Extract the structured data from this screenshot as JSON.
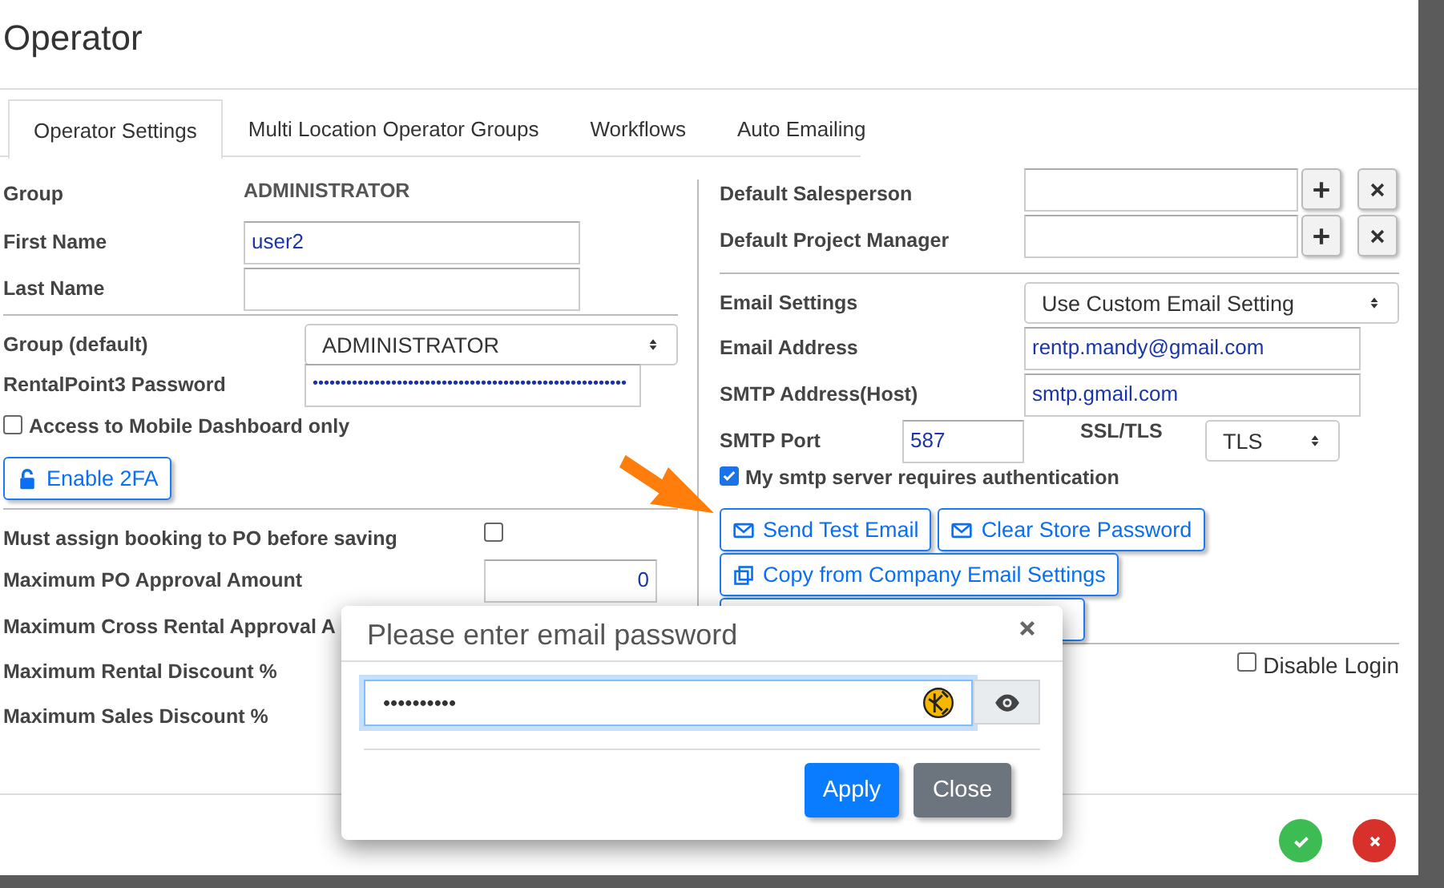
{
  "window": {
    "title": "Operator"
  },
  "tabs": [
    {
      "label": "Operator Settings",
      "selected": true
    },
    {
      "label": "Multi Location Operator Groups",
      "selected": false
    },
    {
      "label": "Workflows",
      "selected": false
    },
    {
      "label": "Auto Emailing",
      "selected": false
    }
  ],
  "left": {
    "sections": [
      [
        {
          "kind": "value",
          "label": "Group",
          "value": "ADMINISTRATOR"
        },
        {
          "kind": "input",
          "label": "First Name",
          "value": "user2"
        },
        {
          "kind": "input",
          "label": "Last Name"
        }
      ],
      [
        {
          "kind": "select",
          "label": "Group (default)",
          "value": "ADMINISTRATOR"
        },
        {
          "kind": "password",
          "label": "RentalPoint3 Password",
          "value": "••••••••••••••••••••••••••••••••••••••••••••••••••••••••"
        },
        {
          "kind": "checkbox",
          "label": "Access to Mobile Dashboard only",
          "checked": false
        },
        {
          "kind": "button",
          "label": "Enable 2FA"
        }
      ],
      [
        {
          "kind": "checkbox_right",
          "label": "Must assign booking to PO before saving",
          "checked": false
        },
        {
          "kind": "number",
          "label": "Maximum PO Approval Amount",
          "value": "0"
        },
        {
          "kind": "label",
          "label": "Maximum Cross Rental Approval A"
        },
        {
          "kind": "label",
          "label": "Maximum Rental Discount %"
        },
        {
          "kind": "label",
          "label": "Maximum Sales Discount %"
        }
      ]
    ]
  },
  "right": {
    "sections": [
      [
        {
          "kind": "lookup",
          "label": "Default Salesperson"
        },
        {
          "kind": "lookup",
          "label": "Default Project Manager"
        }
      ],
      [
        {
          "kind": "select",
          "label": "Email Settings",
          "value": "Use Custom Email Setting"
        },
        {
          "kind": "input",
          "label": "Email Address",
          "value": "rentp.mandy@gmail.com"
        },
        {
          "kind": "input",
          "label": "SMTP Address(Host)",
          "value": "smtp.gmail.com"
        },
        {
          "kind": "port",
          "label": "SMTP Port",
          "value": "587",
          "label_2": "SSL/TLS",
          "value_2": "TLS"
        },
        {
          "kind": "checkbox",
          "label": "My smtp server requires authentication",
          "checked": true
        },
        {
          "kind": "buttons",
          "items": [
            {
              "label": "Send Test Email"
            },
            {
              "label": "Clear Store Password"
            }
          ]
        },
        {
          "kind": "buttons",
          "items": [
            {
              "label": "Copy from Company Email Settings"
            }
          ]
        },
        {
          "kind": "blank_button"
        }
      ],
      [
        {
          "kind": "checkbox_end",
          "label": "Disable Login",
          "checked": false
        }
      ]
    ]
  },
  "modal": {
    "title": "Please enter email password",
    "password": "••••••••••",
    "buttons": [
      {
        "label": "Apply",
        "kind": "primary"
      },
      {
        "label": "Close",
        "kind": "secondary"
      }
    ]
  }
}
